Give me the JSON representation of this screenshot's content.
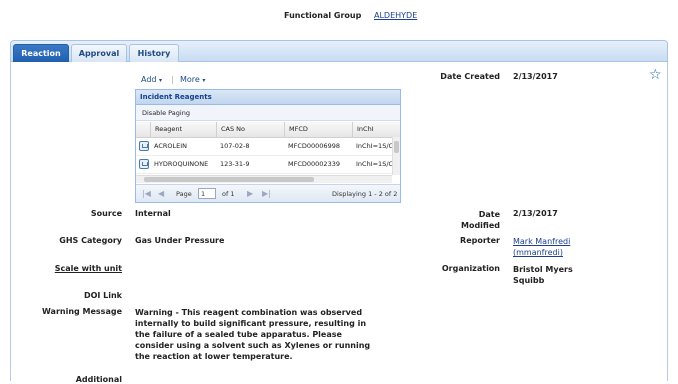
{
  "header": {
    "functional_group_label": "Functional Group",
    "functional_group_value": "ALDEHYDE"
  },
  "tabs": [
    {
      "label": "Reaction",
      "active": true
    },
    {
      "label": "Approval",
      "active": false
    },
    {
      "label": "History",
      "active": false
    }
  ],
  "toolbar": {
    "add_label": "Add",
    "more_label": "More",
    "separator": "|"
  },
  "grid": {
    "title": "Incident Reagents",
    "disable_paging_label": "Disable Paging",
    "columns": [
      "Reagent",
      "CAS No",
      "MFCD",
      "InChI"
    ],
    "rows": [
      {
        "reagent": "ACROLEIN",
        "cas": "107-02-8",
        "mfcd": "MFCD00006998",
        "inchi": "InChI=1S/C"
      },
      {
        "reagent": "HYDROQUINONE",
        "cas": "123-31-9",
        "mfcd": "MFCD00002339",
        "inchi": "InChI=1S/C"
      }
    ],
    "pager": {
      "page_label": "Page",
      "page_value": "1",
      "of_label": "of 1",
      "displaying": "Displaying 1 - 2 of 2"
    }
  },
  "fields": {
    "date_created_label": "Date Created",
    "date_created_value": "2/13/2017",
    "source_label": "Source",
    "source_value": "Internal",
    "date_modified_label_1": "Date",
    "date_modified_label_2": "Modified",
    "date_modified_value": "2/13/2017",
    "ghs_label": "GHS Category",
    "ghs_value": "Gas Under Pressure",
    "reporter_label": "Reporter",
    "reporter_name": "Mark Manfredi",
    "reporter_user": "(mmanfredi)",
    "scale_label": "Scale with unit",
    "organization_label": "Organization",
    "organization_line1": "Bristol Myers",
    "organization_line2": "Squibb",
    "doi_label": "DOI Link",
    "warning_label": "Warning Message",
    "warning_lines": [
      "Warning - This reagent combination was observed",
      "internally to build significant pressure, resulting in",
      "the failure of a sealed tube apparatus. Please",
      "consider using a solvent such as Xylenes or running",
      "the reaction at lower temperature."
    ],
    "additional_label": "Additional"
  },
  "icons": {
    "favorite": "star-icon"
  },
  "colors": {
    "tab_active": "#1f5fae",
    "link": "#1c3f8f",
    "grid_header": "#15428b"
  }
}
